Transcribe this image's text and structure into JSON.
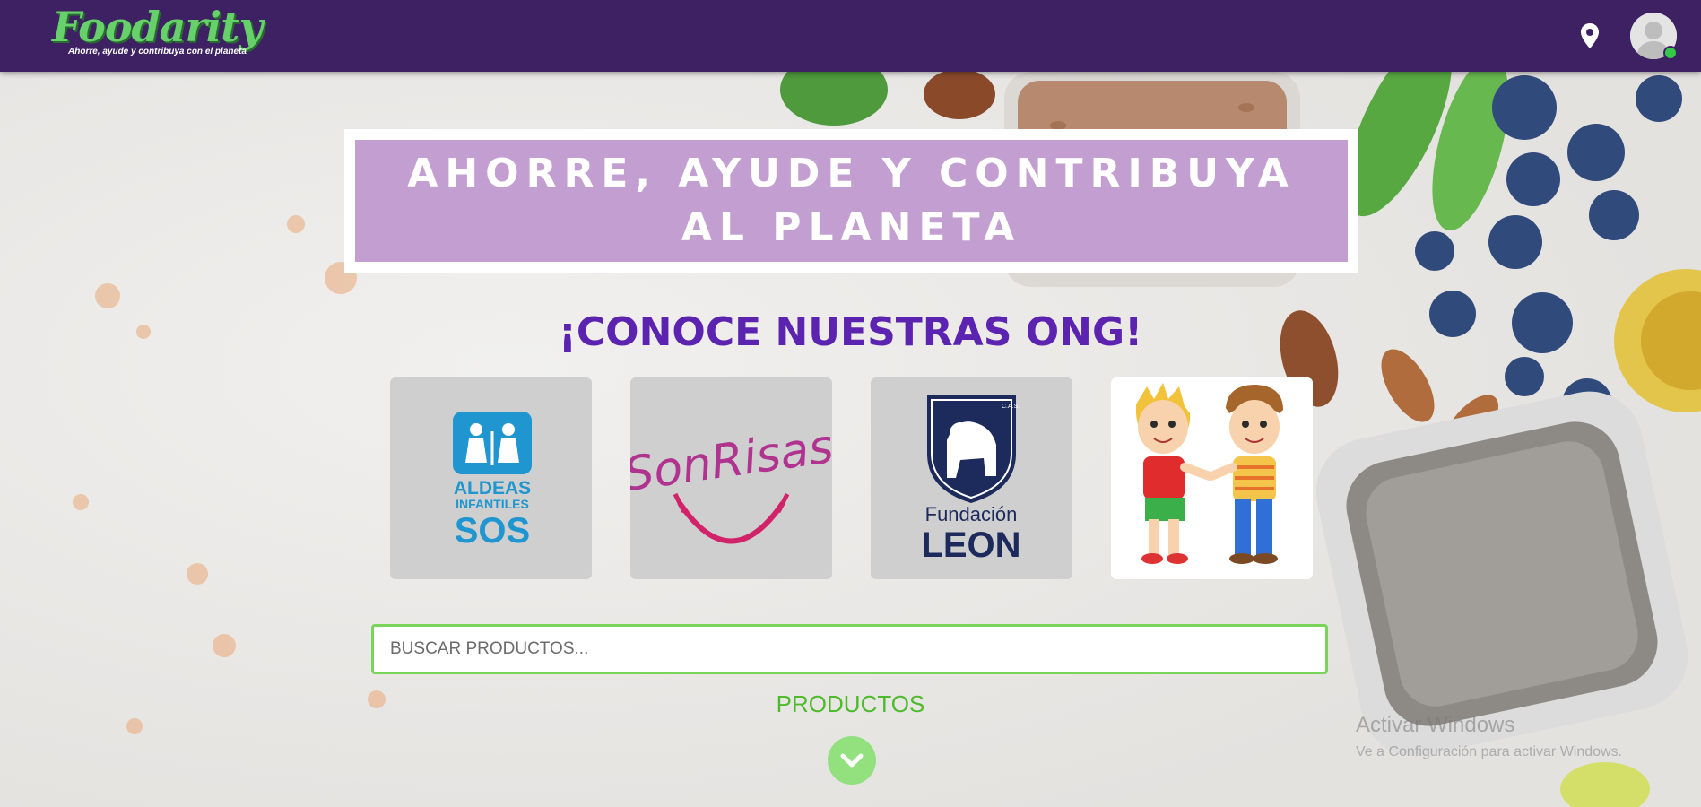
{
  "header": {
    "logo_title": "Foodarity",
    "logo_tagline": "Ahorre, ayude y contribuya con el planeta",
    "location_icon": "location-pin-icon",
    "avatar_icon": "user-avatar-icon",
    "online_status_color": "#34c948"
  },
  "banner": {
    "text": "AHORRE, AYUDE Y CONTRIBUYA AL PLANETA"
  },
  "ong_section": {
    "title": "¡CONOCE NUESTRAS ONG!",
    "cards": [
      {
        "name": "Aldeas Infantiles SOS",
        "line1": "ALDEAS",
        "line2": "INFANTILES",
        "line3": "SOS"
      },
      {
        "name": "Sonrisas",
        "word": "SonRisas"
      },
      {
        "name": "Fundación León",
        "line1": "Fundación",
        "line2": "LEON",
        "crest_mark": "C.A.S."
      },
      {
        "name": "Niños",
        "icon": "kids-handshake-icon"
      }
    ]
  },
  "search": {
    "placeholder": "BUSCAR PRODUCTOS..."
  },
  "products": {
    "label": "PRODUCTOS",
    "scroll_icon": "chevron-down-icon"
  },
  "watermark": {
    "title": "Activar Windows",
    "subtitle": "Ve a Configuración para activar Windows."
  },
  "colors": {
    "navbar": "#3d2163",
    "brand_green": "#66d16a",
    "ong_title": "#5b23b0",
    "accent_green": "#4dbb2c",
    "banner_overlay": "#be96cd"
  }
}
